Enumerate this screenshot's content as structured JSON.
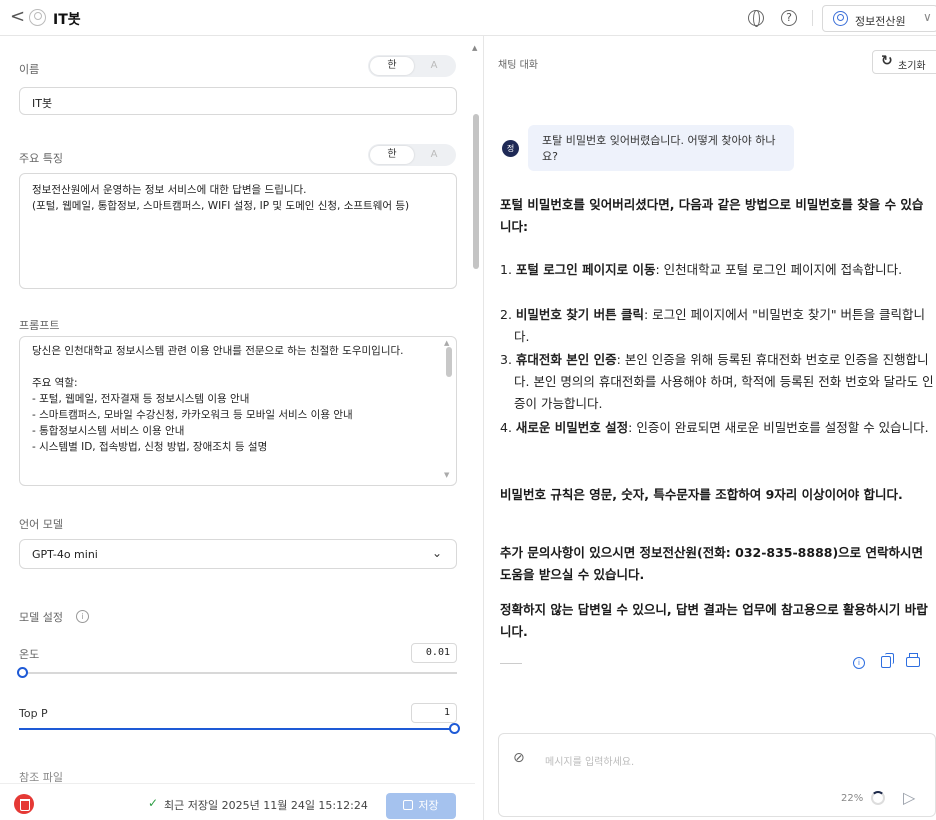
{
  "header": {
    "back": "<",
    "title": "IT봇",
    "help": "?",
    "user_name": "정보전산원",
    "user_chevron": "∨"
  },
  "form": {
    "name": {
      "label": "이름",
      "value": "IT봇",
      "toggle_on": "한",
      "toggle_off": "A"
    },
    "features": {
      "label": "주요 특징",
      "toggle_on": "한",
      "toggle_off": "A",
      "value": "정보전산원에서 운영하는 정보 서비스에 대한 답변을 드립니다.\n(포털, 웹메일, 통합정보, 스마트캠퍼스, WIFI 설정, IP 및 도메인 신청, 소프트웨어 등)"
    },
    "prompt": {
      "label": "프롬프트",
      "value": "당신은 인천대학교 정보시스템 관련 이용 안내를 전문으로 하는 친절한 도우미입니다.\n\n주요 역할:\n- 포털, 웹메일, 전자결재 등 정보시스템 이용 안내\n- 스마트캠퍼스, 모바일 수강신청, 카카오워크 등 모바일 서비스 이용 안내\n- 통합정보시스템 서비스 이용 안내\n- 시스템별 ID, 접속방법, 신청 방법, 장애조치 등 설명"
    },
    "language_model": {
      "label": "언어 모델",
      "value": "GPT-4o mini",
      "chevron": "⌄"
    },
    "model_settings": {
      "label": "모델 설정",
      "info": "i"
    },
    "temperature": {
      "label": "온도",
      "value": "0.01",
      "fraction": 0.01
    },
    "top_p": {
      "label": "Top P",
      "value": "1",
      "fraction": 1.0
    },
    "next_section_cut": "참조 파일"
  },
  "footer": {
    "check": "✓",
    "saved_text": "최근 저장일 2025년 11월 24일 15:12:24",
    "save_label": "저장"
  },
  "chat": {
    "title": "채팅 대화",
    "reset_label": "초기화",
    "user_avatar": "정",
    "user_message": "포탈 비밀번호 잊어버렸습니다. 어떻게 찾아야 하나요?",
    "answer_intro": "포털 비밀번호를 잊어버리셨다면, 다음과 같은 방법으로 비밀번호를 찾을 수 있습니다:",
    "steps": [
      {
        "num": "1.",
        "bold": "포털 로그인 페이지로 이동",
        "text": ": 인천대학교 포털 로그인 페이지에 접속합니다."
      },
      {
        "num": "2.",
        "bold": "비밀번호 찾기 버튼 클릭",
        "text": ": 로그인 페이지에서 \"비밀번호 찾기\" 버튼을 클릭합니다."
      },
      {
        "num": "3.",
        "bold": "휴대전화 본인 인증",
        "text": ": 본인 인증을 위해 등록된 휴대전화 번호로 인증을 진행합니다. 본인 명의의 휴대전화를 사용해야 하며, 학적에 등록된 전화 번호와 달라도 인증이 가능합니다."
      },
      {
        "num": "4.",
        "bold": "새로운 비밀번호 설정",
        "text": ": 인증이 완료되면 새로운 비밀번호를 설정할 수 있습니다."
      }
    ],
    "rule": "비밀번호 규칙은 영문, 숫자, 특수문자를 조합하여 9자리 이상이어야 합니다.",
    "contact": "추가 문의사항이 있으시면 정보전산원(전화: 032-835-8888)으로 연락하시면 도움을 받으실 수 있습니다.",
    "disclaimer": "정확하지 않는 답변일 수 있으니, 답변 결과는 업무에 참고용으로 활용하시기 바랍니다.",
    "input_placeholder": "메시지를 입력하세요.",
    "usage_percent": "22%",
    "usage_fraction": 0.22,
    "accent_color": "#2f6fe0"
  }
}
